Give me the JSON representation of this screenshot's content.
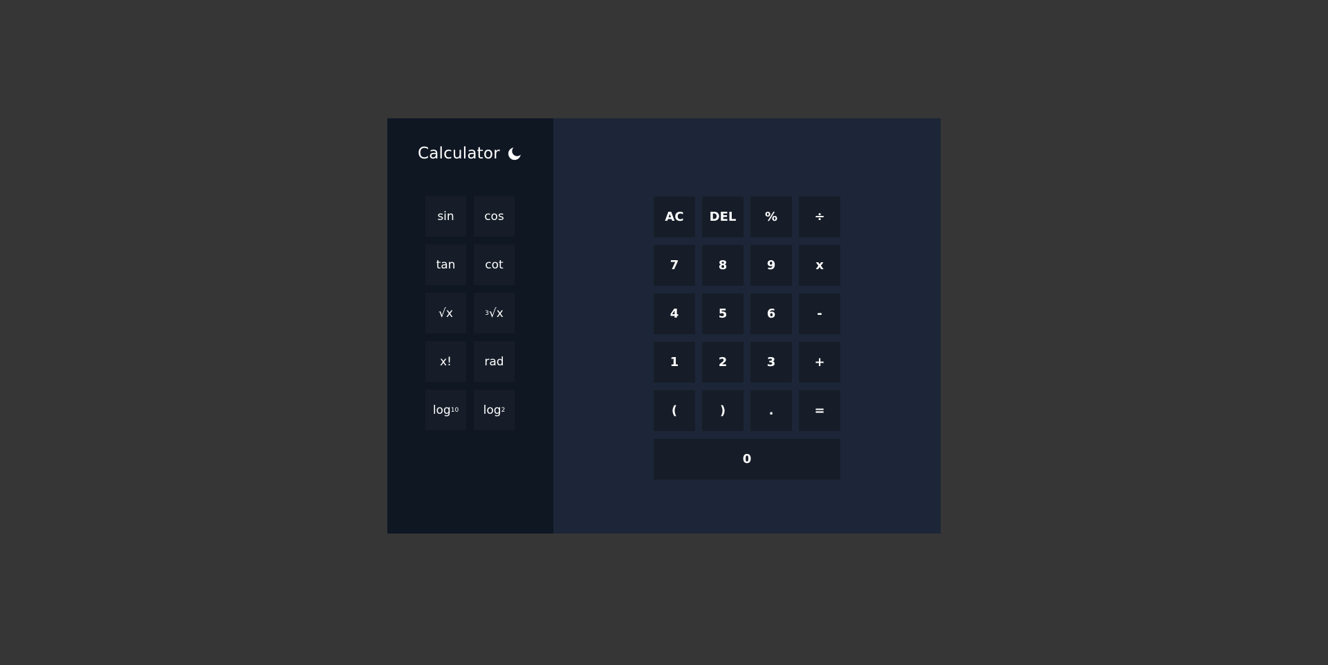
{
  "app": {
    "title": "Calculator",
    "theme_toggle_icon": "moon-icon"
  },
  "colors": {
    "page_background": "#363636",
    "sidebar_background": "#0f1723",
    "main_background": "#1c2638",
    "button_background": "#161d28",
    "text": "#ffffff"
  },
  "scientific": {
    "sin": "sin",
    "cos": "cos",
    "tan": "tan",
    "cot": "cot",
    "sqrt": "√x",
    "cbrt_index": "3",
    "cbrt": "√x",
    "factorial": "x!",
    "rad": "rad",
    "log10_base": "log",
    "log10_sub": "10",
    "log2_base": "log",
    "log2_sub": "2"
  },
  "keypad": {
    "ac": "AC",
    "del": "DEL",
    "percent": "%",
    "divide": "÷",
    "seven": "7",
    "eight": "8",
    "nine": "9",
    "multiply": "x",
    "four": "4",
    "five": "5",
    "six": "6",
    "minus": "-",
    "one": "1",
    "two": "2",
    "three": "3",
    "plus": "+",
    "open_paren": "(",
    "close_paren": ")",
    "decimal": ".",
    "equals": "=",
    "zero": "0"
  }
}
